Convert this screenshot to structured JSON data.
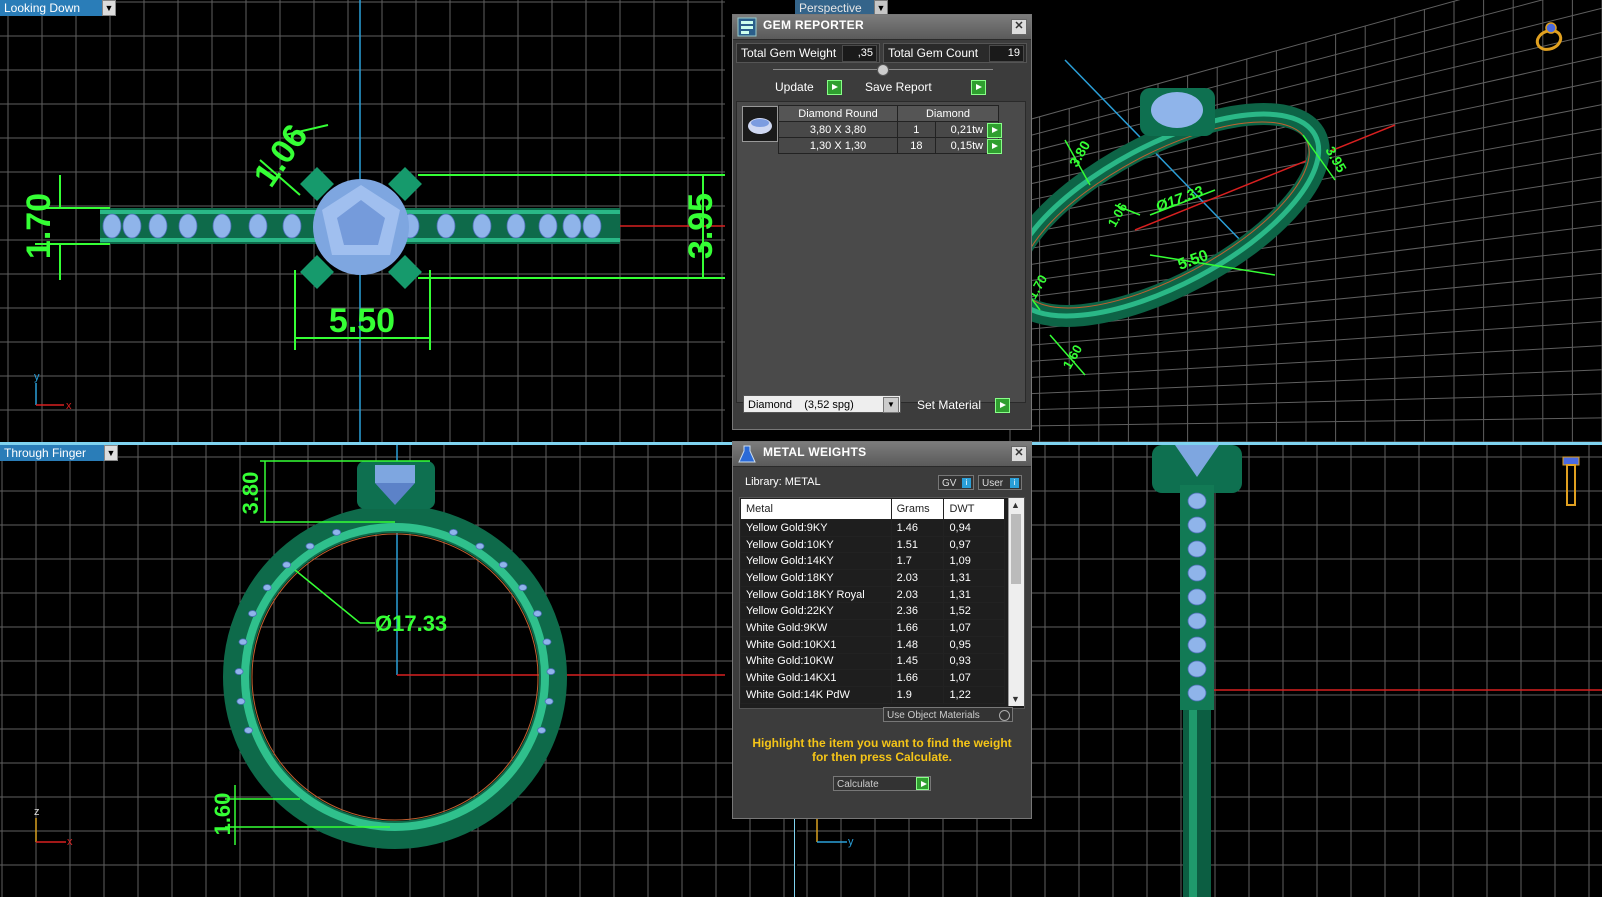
{
  "viewports": {
    "top_left_label": "Looking Down",
    "top_right_label": "Perspective",
    "bottom_left_label": "Through Finger"
  },
  "dimensions": {
    "top": {
      "d1": "1.06",
      "d2": "1.70",
      "d3": "3.95",
      "d4": "5.50"
    },
    "perspective": {
      "d1": "3.80",
      "d2": "3.95",
      "d3": "1.06",
      "d4": "Ø17.33",
      "d5": "5.50",
      "d6": "1.70",
      "d7": "1.60"
    },
    "side": {
      "d1": "3.80",
      "d2": "Ø17.33",
      "d3": "1.60"
    }
  },
  "axes": {
    "x": "x",
    "y": "y",
    "z": "z"
  },
  "gem_reporter": {
    "title": "GEM REPORTER",
    "total_weight_label": "Total Gem Weight",
    "total_weight": ",35",
    "total_count_label": "Total Gem Count",
    "total_count": "19",
    "update_label": "Update",
    "save_label": "Save Report",
    "table_header": [
      "Diamond Round",
      "Diamond"
    ],
    "rows": [
      {
        "size": "3,80 X 3,80",
        "count": "1",
        "weight": "0,21tw"
      },
      {
        "size": "1,30 X 1,30",
        "count": "18",
        "weight": "0,15tw"
      }
    ],
    "material_select": "Diamond    (3,52 spg)",
    "set_material_label": "Set Material"
  },
  "metal_weights": {
    "title": "METAL WEIGHTS",
    "library_label": "Library: METAL",
    "gv_label": "GV",
    "user_label": "User",
    "columns": [
      "Metal",
      "Grams",
      "DWT"
    ],
    "rows": [
      {
        "metal": "Yellow Gold:9KY",
        "grams": "1.46",
        "dwt": "0,94"
      },
      {
        "metal": "Yellow Gold:10KY",
        "grams": "1.51",
        "dwt": "0,97"
      },
      {
        "metal": "Yellow Gold:14KY",
        "grams": "1.7",
        "dwt": "1,09"
      },
      {
        "metal": "Yellow Gold:18KY",
        "grams": "2.03",
        "dwt": "1,31"
      },
      {
        "metal": "Yellow Gold:18KY Royal",
        "grams": "2.03",
        "dwt": "1,31"
      },
      {
        "metal": "Yellow Gold:22KY",
        "grams": "2.36",
        "dwt": "1,52"
      },
      {
        "metal": "White Gold:9KW",
        "grams": "1.66",
        "dwt": "1,07"
      },
      {
        "metal": "White Gold:10KX1",
        "grams": "1.48",
        "dwt": "0,95"
      },
      {
        "metal": "White Gold:10KW",
        "grams": "1.45",
        "dwt": "0,93"
      },
      {
        "metal": "White Gold:14KX1",
        "grams": "1.66",
        "dwt": "1,07"
      },
      {
        "metal": "White Gold:14K PdW",
        "grams": "1.9",
        "dwt": "1,22"
      }
    ],
    "use_object_materials": "Use Object Materials",
    "hint_line1": "Highlight the item you want to find the weight",
    "hint_line2": "for then press Calculate.",
    "calculate_label": "Calculate"
  },
  "colors": {
    "background": "#000000",
    "grid": "#7a7a7a",
    "ring_metal": "#0f7a55",
    "gem": "#8fb4ea",
    "dimension": "#35ff35",
    "axis_blue": "#2a9fd8",
    "axis_red": "#d82020",
    "hint_text": "#f5c518"
  }
}
